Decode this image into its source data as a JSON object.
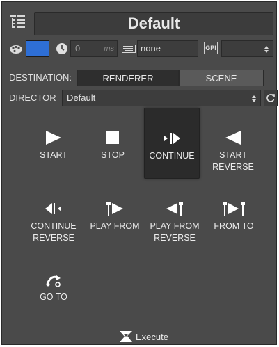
{
  "header": {
    "title": "Default"
  },
  "toolbar": {
    "color": "#2e6fd6",
    "time_value": "0",
    "time_unit": "ms",
    "keys_value": "none",
    "gpi_label": "GPI",
    "gpi_value": ""
  },
  "destination": {
    "label": "DESTINATION:",
    "options": [
      "RENDERER",
      "SCENE"
    ],
    "selected": "RENDERER"
  },
  "director": {
    "label": "DIRECTOR",
    "value": "Default"
  },
  "buttons": {
    "start": [
      "START"
    ],
    "stop": [
      "STOP"
    ],
    "continue": [
      "CONTINUE"
    ],
    "start_reverse": [
      "START",
      "REVERSE"
    ],
    "continue_reverse": [
      "CONTINUE",
      "REVERSE"
    ],
    "play_from": [
      "PLAY FROM"
    ],
    "play_from_reverse": [
      "PLAY FROM",
      "REVERSE"
    ],
    "from_to": [
      "FROM TO"
    ],
    "go_to": [
      "GO TO"
    ]
  },
  "footer": {
    "execute_label": "Execute"
  }
}
